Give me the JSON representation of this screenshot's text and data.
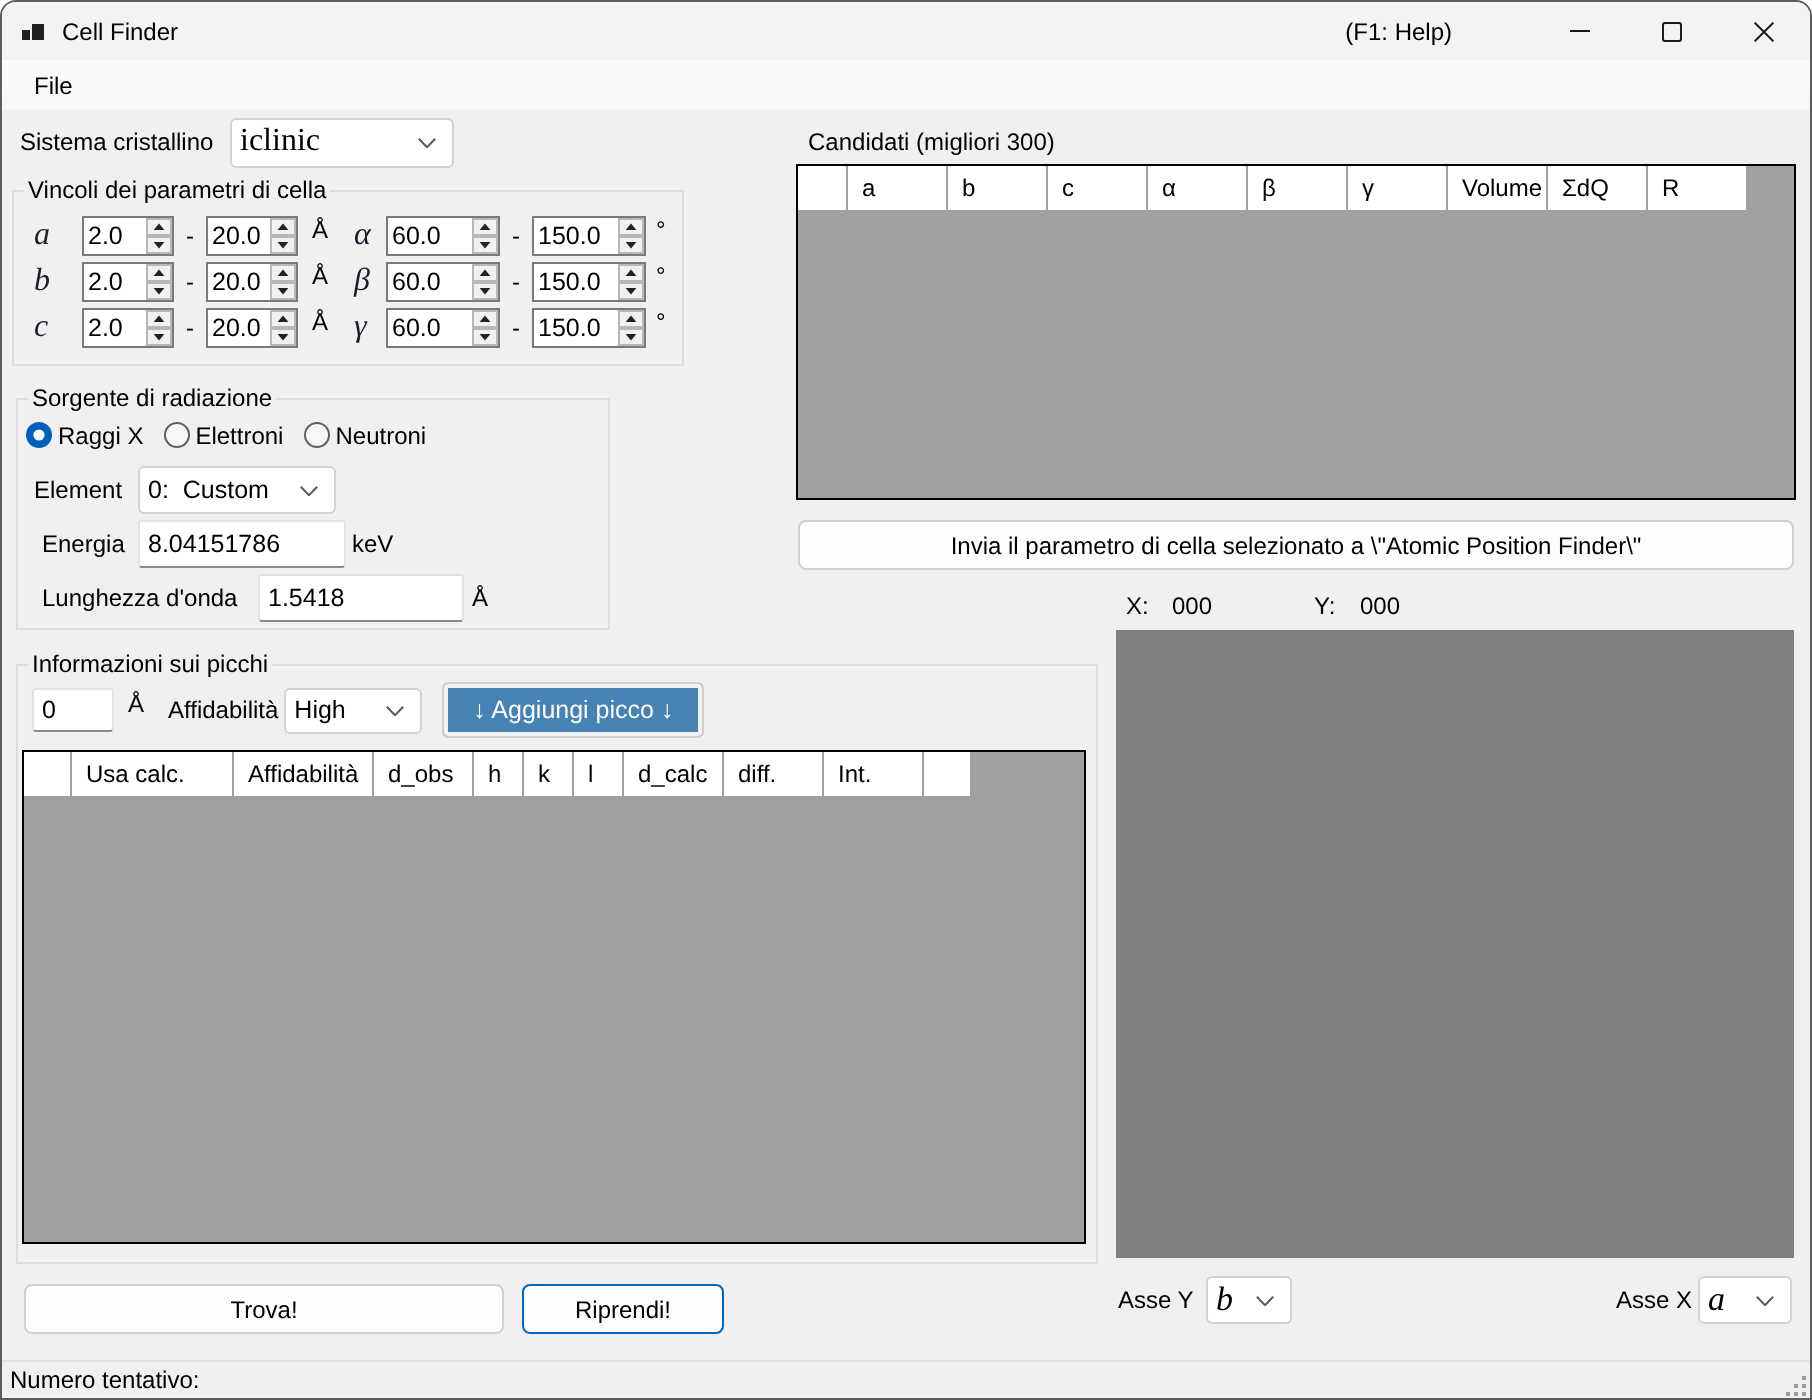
{
  "window": {
    "title": "Cell Finder",
    "help_hint": "(F1: Help)"
  },
  "menu": [
    "File"
  ],
  "crystal_system": {
    "label": "Sistema cristallino",
    "value": "iclinic"
  },
  "cell_constraints": {
    "title": "Vincoli dei parametri di cella",
    "rows": [
      {
        "length": {
          "symbol": "a",
          "min": "2.0",
          "separator": "-",
          "max": "20.0",
          "unit": "Å"
        },
        "angle": {
          "symbol": "α",
          "min": "60.0",
          "separator": "-",
          "max": "150.0",
          "unit": "°"
        }
      },
      {
        "length": {
          "symbol": "b",
          "min": "2.0",
          "separator": "-",
          "max": "20.0",
          "unit": "Å"
        },
        "angle": {
          "symbol": "β",
          "min": "60.0",
          "separator": "-",
          "max": "150.0",
          "unit": "°"
        }
      },
      {
        "length": {
          "symbol": "c",
          "min": "2.0",
          "separator": "-",
          "max": "20.0",
          "unit": "Å"
        },
        "angle": {
          "symbol": "γ",
          "min": "60.0",
          "separator": "-",
          "max": "150.0",
          "unit": "°"
        }
      }
    ]
  },
  "candidates": {
    "title": "Candidati (migliori 300)",
    "columns": [
      "a",
      "b",
      "c",
      "α",
      "β",
      "γ",
      "Volume",
      "ΣdQ",
      "R"
    ]
  },
  "send_button": "Invia il parametro di cella selezionato a \\\"Atomic Position Finder\\\"",
  "radiation_source": {
    "title": "Sorgente di radiazione",
    "options": [
      {
        "label": "Raggi X",
        "selected": true
      },
      {
        "label": "Elettroni",
        "selected": false
      },
      {
        "label": "Neutroni",
        "selected": false
      }
    ],
    "element": {
      "label": "Element",
      "value": "0:  Custom"
    },
    "energy": {
      "label": "Energia",
      "value": "8.04151786",
      "unit": "keV"
    },
    "wavelength": {
      "label": "Lunghezza d'onda",
      "value": "1.5418",
      "unit": "Å"
    }
  },
  "cursor": {
    "x_label": "X:",
    "x_value": "000",
    "y_label": "Y:",
    "y_value": "000"
  },
  "peaks": {
    "title": "Informazioni sui picchi",
    "d_value": "0",
    "d_unit": "Å",
    "reliability": {
      "label": "Affidabilità",
      "value": "High"
    },
    "add_button": "↓ Aggiungi picco ↓",
    "columns": [
      "Usa calc.",
      "Affidabilità",
      "d_obs",
      "h",
      "k",
      "l",
      "d_calc",
      "diff.",
      "Int."
    ]
  },
  "actions": [
    {
      "label": "Trova!",
      "focused": false
    },
    {
      "label": "Riprendi!",
      "focused": true
    }
  ],
  "axes": {
    "y": {
      "label": "Asse Y",
      "value": "b"
    },
    "x": {
      "label": "Asse X",
      "value": "a"
    }
  },
  "status_bar": {
    "text": "Numero tentativo:"
  }
}
